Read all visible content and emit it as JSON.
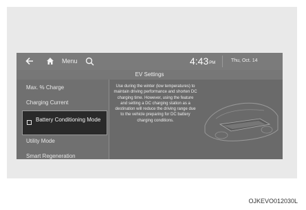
{
  "topbar": {
    "menu_label": "Menu",
    "time": "4:43",
    "ampm": "PM",
    "date": "Thu, Oct. 14"
  },
  "header": {
    "title": "EV Settings"
  },
  "list": {
    "items": [
      {
        "label": "Max. % Charge"
      },
      {
        "label": "Charging Current"
      },
      {
        "label": "Battery Conditioning Mode",
        "selected": true,
        "checked": false
      },
      {
        "label": "Utility Mode"
      },
      {
        "label": "Smart Regeneration"
      }
    ]
  },
  "description": "Use during the winter (low temperatures) to maintain driving performance and shorten DC charging time. However, using the feature and setting a DC charging station as a destination will reduce the driving range due to the vehicle preparing for DC battery charging conditions.",
  "caption": "OJKEVO012030L",
  "colors": {
    "screen_bg": "#6a6a6a",
    "selected_bg": "#2a2a2a",
    "frame_bg": "#e9e9e9"
  }
}
